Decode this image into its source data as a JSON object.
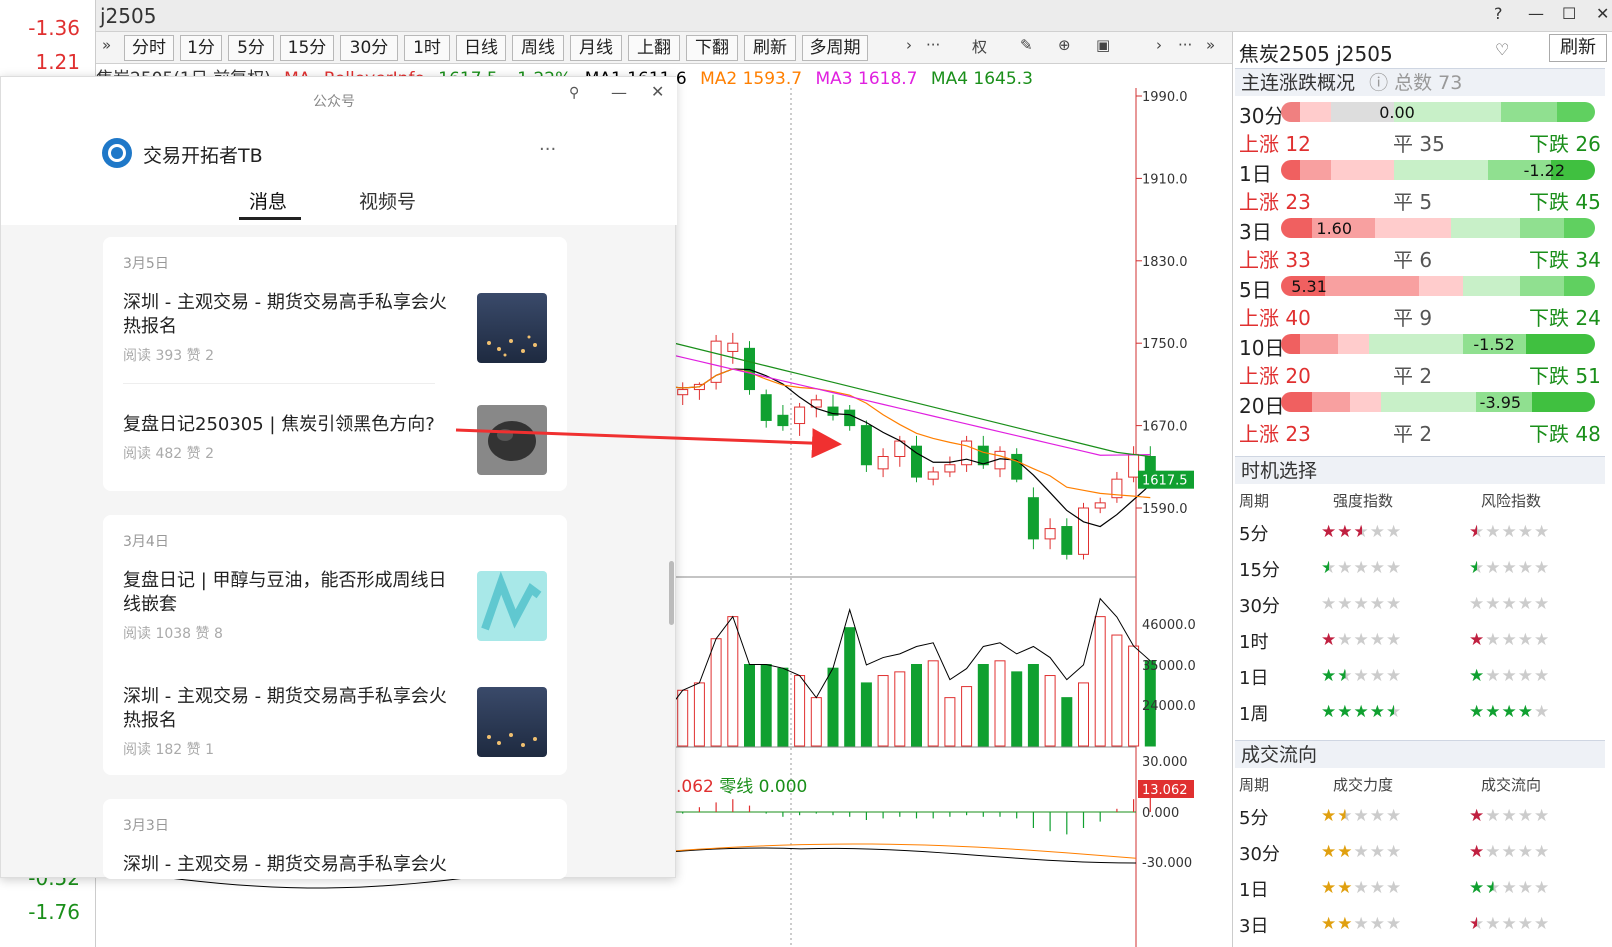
{
  "left_values": [
    {
      "text": "-1.36",
      "color": "#e03030"
    },
    {
      "text": "1.21",
      "color": "#e03030"
    },
    {
      "text": "-0.52",
      "color": "#1a8f1a"
    },
    {
      "text": "-1.76",
      "color": "#1a8f1a"
    }
  ],
  "window": {
    "title": "j2505"
  },
  "toolbar": {
    "buttons": [
      "分时",
      "1分",
      "5分",
      "15分",
      "30分",
      "1时",
      "日线",
      "周线",
      "月线",
      "上翻",
      "下翻",
      "刷新",
      "多周期"
    ],
    "extra_icons": [
      "»",
      "›",
      "···",
      "权",
      "✎",
      "⊕",
      "▣",
      "›",
      "···",
      "»"
    ]
  },
  "legend": {
    "title": "焦炭2505(1日 前复权)",
    "ma_label": "MA",
    "rollover": "RolloverInfo",
    "price": "1617.5",
    "pct": "-1.22%",
    "ma1": "MA1 1611.6",
    "ma2": "MA2 1593.7",
    "ma3": "MA3 1618.7",
    "ma4": "MA4 1645.3",
    "macd_val": ".062",
    "zero_line": "零线 0.000"
  },
  "axis": {
    "price_ticks": [
      "1990.0",
      "1910.0",
      "1830.0",
      "1750.0",
      "1670.0",
      "1590.0"
    ],
    "current_price": "1617.5",
    "vol_ticks": [
      "46000.0",
      "35000.0",
      "24000.0"
    ],
    "macd_ticks": [
      "30.000",
      "0.000",
      "-30.000"
    ],
    "macd_current": "13.062"
  },
  "right_panel": {
    "symbol": "焦炭2505 j2505",
    "refresh": "刷新",
    "overview_title": "主连涨跌概况",
    "total_label": "总数 73",
    "periods": [
      {
        "label": "30分",
        "val": "0.00",
        "up": "上涨 12",
        "flat": "平 35",
        "down": "下跌 26"
      },
      {
        "label": "1日",
        "val": "-1.22",
        "up": "上涨 23",
        "flat": "平 5",
        "down": "下跌 45"
      },
      {
        "label": "3日",
        "val": "1.60",
        "up": "上涨 33",
        "flat": "平 6",
        "down": "下跌 34"
      },
      {
        "label": "5日",
        "val": "5.31",
        "up": "上涨 40",
        "flat": "平 9",
        "down": "下跌 24"
      },
      {
        "label": "10日",
        "val": "-1.52",
        "up": "上涨 20",
        "flat": "平 2",
        "down": "下跌 51"
      },
      {
        "label": "20日",
        "val": "-3.95",
        "up": "上涨 23",
        "flat": "平 2",
        "down": "下跌 48"
      }
    ],
    "timing_title": "时机选择",
    "timing_cols": [
      "周期",
      "强度指数",
      "风险指数"
    ],
    "timing_rows": [
      {
        "label": "5分",
        "s1": 2.5,
        "s2": 0.5
      },
      {
        "label": "15分",
        "s1": 0.5,
        "s2": 0.5
      },
      {
        "label": "30分",
        "s1": 0,
        "s2": 0
      },
      {
        "label": "1时",
        "s1": 1,
        "s2": 1
      },
      {
        "label": "1日",
        "s1": 1.5,
        "s2": 1
      },
      {
        "label": "1周",
        "s1": 4.5,
        "s2": 4
      }
    ],
    "flow_title": "成交流向",
    "flow_cols": [
      "周期",
      "成交力度",
      "成交流向"
    ],
    "flow_rows": [
      {
        "label": "5分",
        "s1": 1.5,
        "s2": 1
      },
      {
        "label": "30分",
        "s1": 2,
        "s2": 1
      },
      {
        "label": "1日",
        "s1": 2,
        "s2": 1.5
      },
      {
        "label": "3日",
        "s1": 2,
        "s2": 0.5
      }
    ]
  },
  "popup": {
    "window_title": "公众号",
    "account": "交易开拓者TB",
    "more": "···",
    "tabs": [
      "消息",
      "视频号"
    ],
    "cards": [
      {
        "date": "3月5日",
        "items": [
          {
            "title": "深圳 - 主观交易 - 期货交易高手私享会火热报名",
            "meta": "阅读 393  赞 2"
          },
          {
            "title": "复盘日记250305 | 焦炭引领黑色方向?",
            "meta": "阅读 482  赞 2"
          }
        ]
      },
      {
        "date": "3月4日",
        "items": [
          {
            "title": "复盘日记 | 甲醇与豆油，能否形成周线日线嵌套",
            "meta": "阅读 1038  赞 8"
          },
          {
            "title": "深圳 - 主观交易 - 期货交易高手私享会火热报名",
            "meta": "阅读 182  赞 1"
          }
        ]
      },
      {
        "date": "3月3日",
        "items": [
          {
            "title": "深圳 - 主观交易 - 期货交易高手私享会火",
            "meta": ""
          }
        ]
      }
    ]
  },
  "colors": {
    "up": "#e03030",
    "down": "#10a030",
    "ma1": "#000000",
    "ma2": "#ff7f00",
    "ma3": "#e020e0",
    "ma4": "#1a8f1a"
  }
}
